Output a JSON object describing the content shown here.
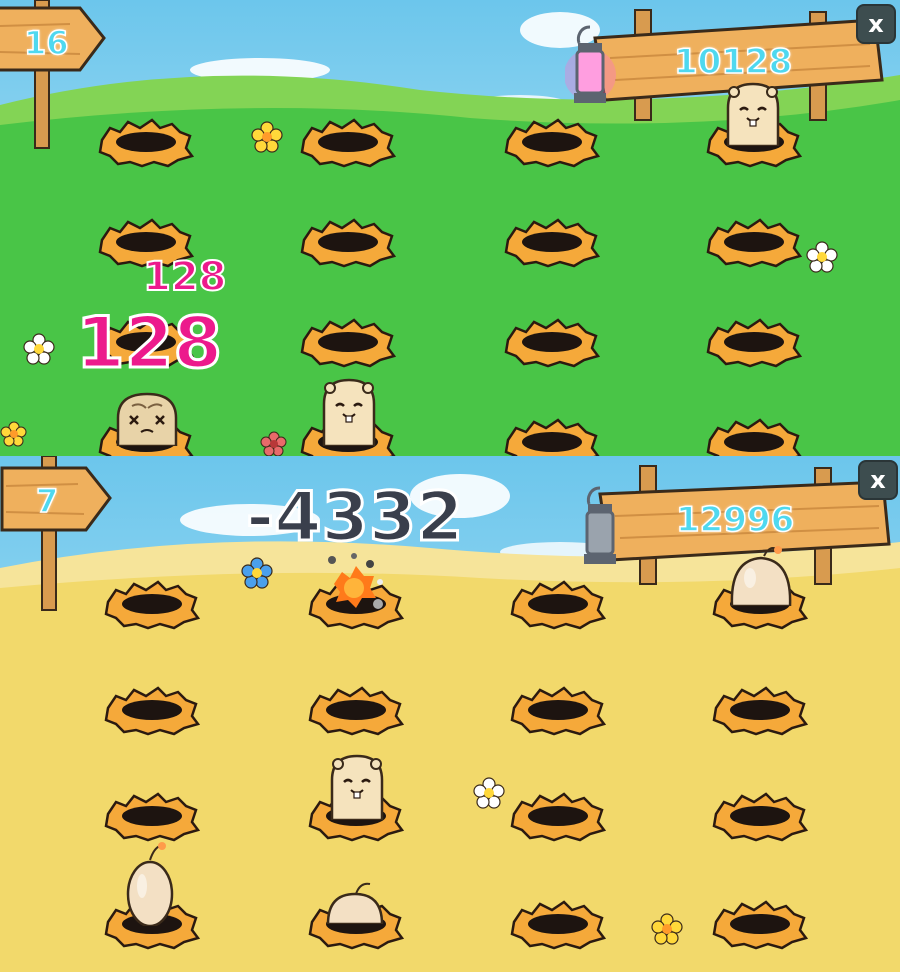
{
  "top_game": {
    "timer": "16",
    "score": "10128",
    "close_label": "x",
    "popup_small": "128",
    "popup_large": "128",
    "colors": {
      "sky": "#8fd3ee",
      "grass": "#44c54a",
      "score_text": "#4fd8ef",
      "popup": "#ec1a8c"
    }
  },
  "bottom_game": {
    "timer": "7",
    "score": "12996",
    "close_label": "x",
    "penalty": "-4332",
    "colors": {
      "sky": "#8fd3ee",
      "sand": "#f2dc73",
      "score_text": "#4fd8ef",
      "penalty": "#3a3f4c"
    }
  },
  "icons": [
    "close-icon",
    "lantern-icon",
    "flower-icon",
    "hole-icon",
    "hamster-icon",
    "bomb-icon",
    "explosion-icon"
  ]
}
